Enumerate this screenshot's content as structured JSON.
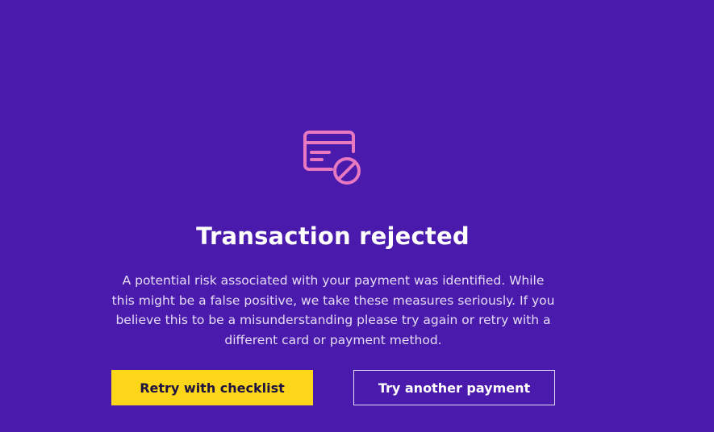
{
  "theme": {
    "background": "#4a1aad",
    "icon_color": "#e879c0",
    "primary_button_color": "#fcd619",
    "primary_button_text_color": "#1e1240",
    "text_color": "#ffffff"
  },
  "icon": {
    "name": "card-declined-icon"
  },
  "title": "Transaction rejected",
  "message": "A potential risk associated with your payment was identified. While this might be a false positive, we take these measures seriously. If you believe this to be a misunderstanding please try again or retry with a different card or payment method.",
  "actions": {
    "primary_label": "Retry with checklist",
    "secondary_label": "Try another payment"
  }
}
